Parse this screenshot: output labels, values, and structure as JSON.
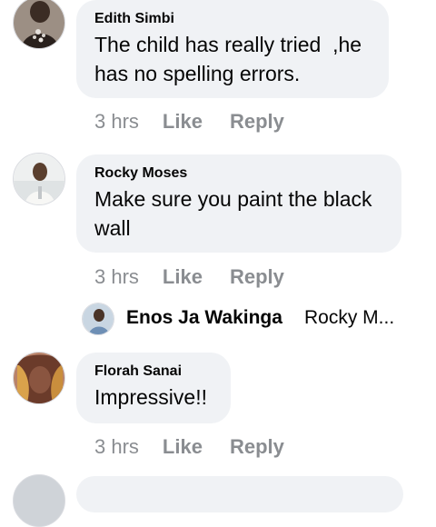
{
  "comments": [
    {
      "author": "Edith Simbi",
      "text": "The child has really tried  ,he\nhas no spelling errors.",
      "time": "3 hrs",
      "like_label": "Like",
      "reply_label": "Reply"
    },
    {
      "author": "Rocky Moses",
      "text": "Make sure you paint the black\nwall",
      "time": "3 hrs",
      "like_label": "Like",
      "reply_label": "Reply"
    },
    {
      "author": "Florah Sanai",
      "text": "Impressive!!",
      "time": "3 hrs",
      "like_label": "Like",
      "reply_label": "Reply"
    }
  ],
  "reply_preview": {
    "author": "Enos Ja Wakinga",
    "snippet": "Rocky M..."
  },
  "colors": {
    "bubble": "#f0f2f5",
    "meta_text": "#8a8d91",
    "text": "#050505"
  }
}
